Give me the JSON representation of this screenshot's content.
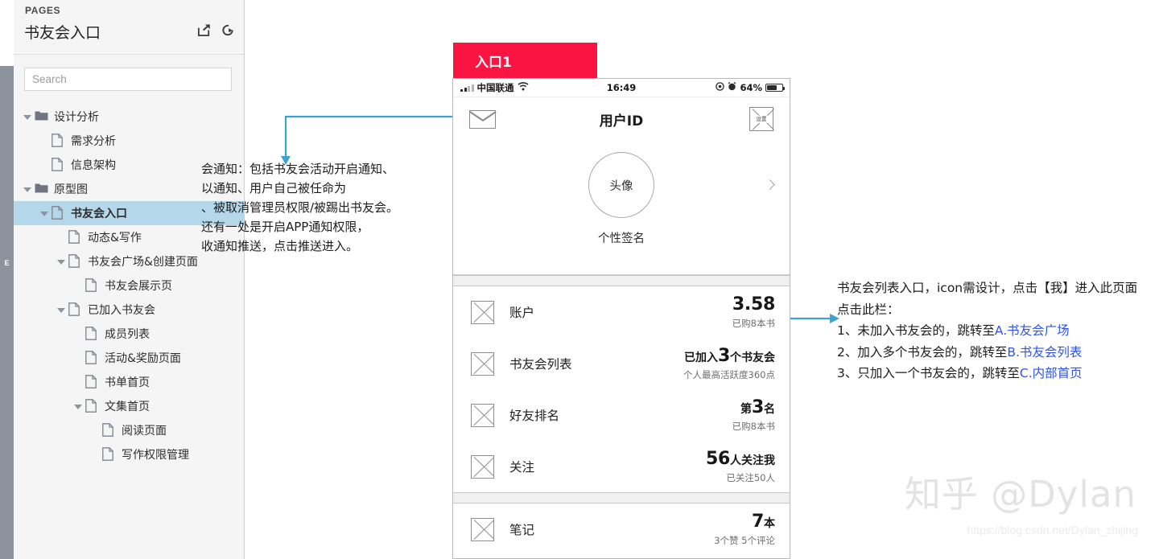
{
  "sidebar": {
    "edge_strip_label": "E",
    "pages_label": "PAGES",
    "page_title": "书友会入口",
    "header_icons": [
      {
        "name": "open-external-icon"
      },
      {
        "name": "preview-refresh-icon"
      }
    ],
    "search": {
      "value": "",
      "placeholder": "Search"
    },
    "tree": [
      {
        "label": "设计分析",
        "depth": 0,
        "type": "folder",
        "caret": true,
        "selected": false,
        "bold": false
      },
      {
        "label": "需求分析",
        "depth": 1,
        "type": "page",
        "caret": false,
        "selected": false,
        "bold": false
      },
      {
        "label": "信息架构",
        "depth": 1,
        "type": "page",
        "caret": false,
        "selected": false,
        "bold": false
      },
      {
        "label": "原型图",
        "depth": 0,
        "type": "folder",
        "caret": true,
        "selected": false,
        "bold": false
      },
      {
        "label": "书友会入口",
        "depth": 1,
        "type": "page",
        "caret": true,
        "selected": true,
        "bold": true
      },
      {
        "label": "动态&写作",
        "depth": 2,
        "type": "page",
        "caret": false,
        "selected": false,
        "bold": false
      },
      {
        "label": "书友会广场&创建页面",
        "depth": 2,
        "type": "page",
        "caret": true,
        "selected": false,
        "bold": false
      },
      {
        "label": "书友会展示页",
        "depth": 3,
        "type": "page",
        "caret": false,
        "selected": false,
        "bold": false
      },
      {
        "label": "已加入书友会",
        "depth": 2,
        "type": "page",
        "caret": true,
        "selected": false,
        "bold": false
      },
      {
        "label": "成员列表",
        "depth": 3,
        "type": "page",
        "caret": false,
        "selected": false,
        "bold": false
      },
      {
        "label": "活动&奖励页面",
        "depth": 3,
        "type": "page",
        "caret": false,
        "selected": false,
        "bold": false
      },
      {
        "label": "书单首页",
        "depth": 3,
        "type": "page",
        "caret": false,
        "selected": false,
        "bold": false
      },
      {
        "label": "文集首页",
        "depth": 3,
        "type": "page",
        "caret": true,
        "selected": false,
        "bold": false
      },
      {
        "label": "阅读页面",
        "depth": 4,
        "type": "page",
        "caret": false,
        "selected": false,
        "bold": false
      },
      {
        "label": "写作权限管理",
        "depth": 4,
        "type": "page",
        "caret": false,
        "selected": false,
        "bold": false
      }
    ]
  },
  "canvas": {
    "tab_banner": {
      "label": "入口1",
      "color": "#fa1441"
    },
    "phone": {
      "statusbar": {
        "carrier": "中国联通",
        "time": "16:49",
        "battery": "64%"
      },
      "navbar": {
        "title": "用户ID",
        "mail_icon": "envelope-icon",
        "settings_icon_label": "设置"
      },
      "profile": {
        "avatar_label": "头像",
        "signature": "个性签名"
      },
      "rows_group_1": [
        {
          "label": "账户",
          "value_prefix": "",
          "value_big": "3.58",
          "value_suffix": "",
          "sub": "已购8本书"
        },
        {
          "label": "书友会列表",
          "value_prefix": "已加入",
          "value_big": "3",
          "value_suffix": "个书友会",
          "sub": "个人最高活跃度360点"
        },
        {
          "label": "好友排名",
          "value_prefix": "第",
          "value_big": "3",
          "value_suffix": "名",
          "sub": "已购8本书"
        },
        {
          "label": "关注",
          "value_prefix": "",
          "value_big": "56",
          "value_suffix": "人关注我",
          "sub": "已关注50人"
        }
      ],
      "rows_group_2": [
        {
          "label": "笔记",
          "value_prefix": "",
          "value_big": "7",
          "value_suffix": "本",
          "sub": "3个赞 5个评论"
        }
      ]
    }
  },
  "annotations": {
    "left": {
      "lines": [
        "会通知：包括书友会活动开启通知、",
        "以通知、用户自己被任命为",
        "、被取消管理员权限/被踢出书友会。",
        "还有一处是开启APP通知权限，",
        "收通知推送，点击推送进入。"
      ],
      "connector_color": "#3ca3cf"
    },
    "right": {
      "line1": "书友会列表入口，icon需设计，点击【我】进入此页面",
      "line2": "点击此栏：",
      "items": [
        {
          "prefix": "1、未加入书友会的，跳转至",
          "link": "A.书友会广场"
        },
        {
          "prefix": "2、加入多个书友会的，跳转至",
          "link": "B.书友会列表"
        },
        {
          "prefix": "3、只加入一个书友会的，跳转至",
          "link": "C.内部首页"
        }
      ],
      "link_color": "#2f54eb",
      "connector_color": "#3ca3cf"
    }
  },
  "watermark": {
    "text": "知乎 @Dylan",
    "url": "https://blog.csdn.net/Dylan_zhijing"
  }
}
